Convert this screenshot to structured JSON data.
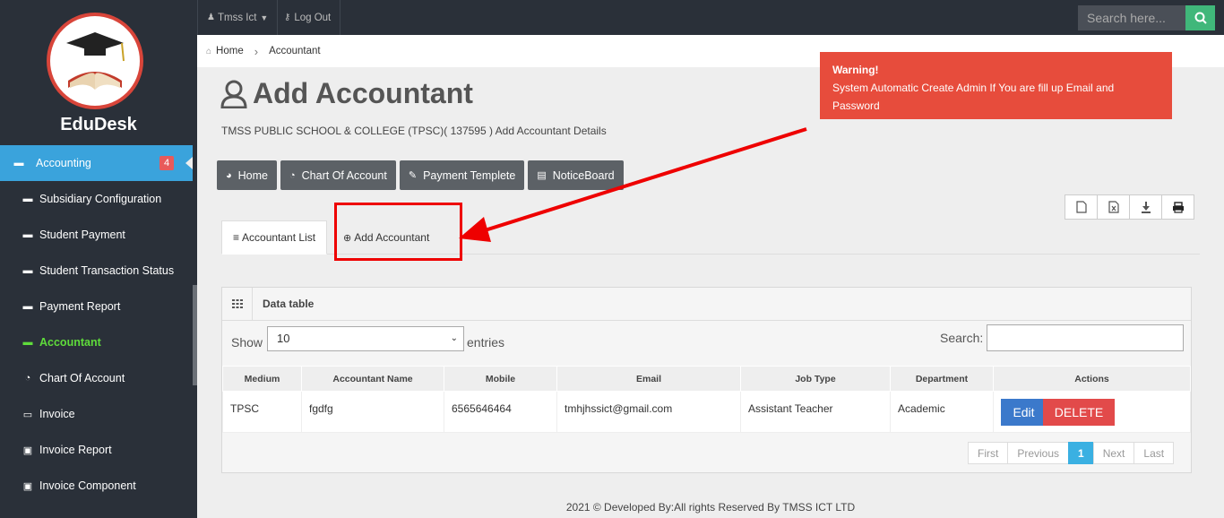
{
  "sidebar": {
    "brand": "EduDesk",
    "items": [
      {
        "label": "Accounting",
        "badge": "4"
      },
      {
        "label": "Subsidiary Configuration"
      },
      {
        "label": "Student Payment"
      },
      {
        "label": "Student Transaction Status"
      },
      {
        "label": "Payment Report"
      },
      {
        "label": "Accountant"
      },
      {
        "label": "Chart Of Account"
      },
      {
        "label": "Invoice"
      },
      {
        "label": "Invoice Report"
      },
      {
        "label": "Invoice Component"
      }
    ]
  },
  "topbar": {
    "user": "Tmss Ict",
    "logout": "Log Out",
    "search_placeholder": "Search here..."
  },
  "breadcrumb": {
    "home": "Home",
    "current": "Accountant"
  },
  "page": {
    "title": "Add Accountant",
    "subtitle": "TMSS PUBLIC SCHOOL & COLLEGE (TPSC)( 137595 ) Add Accountant Details"
  },
  "warning": {
    "title": "Warning!",
    "message": "System Automatic Create Admin If You are fill up Email and Password"
  },
  "buttons": {
    "home": "Home",
    "chart": "Chart Of Account",
    "payment": "Payment Templete",
    "notice": "NoticeBoard"
  },
  "tabs": {
    "list": "Accountant List",
    "add": "Add Accountant"
  },
  "table": {
    "panel_title": "Data table",
    "show": "Show",
    "entries_value": "10",
    "entries": "entries",
    "search": "Search:",
    "columns": [
      "Medium",
      "Accountant Name",
      "Mobile",
      "Email",
      "Job Type",
      "Department",
      "Actions"
    ],
    "rows": [
      {
        "medium": "TPSC",
        "name": "fgdfg",
        "mobile": "6565646464",
        "email": "tmhjhssict@gmail.com",
        "job": "Assistant Teacher",
        "dept": "Academic"
      }
    ],
    "edit": "Edit",
    "delete": "DELETE"
  },
  "pager": {
    "first": "First",
    "previous": "Previous",
    "current": "1",
    "next": "Next",
    "last": "Last"
  },
  "footer": "2021 © Developed By:All rights Reserved By TMSS ICT LTD"
}
